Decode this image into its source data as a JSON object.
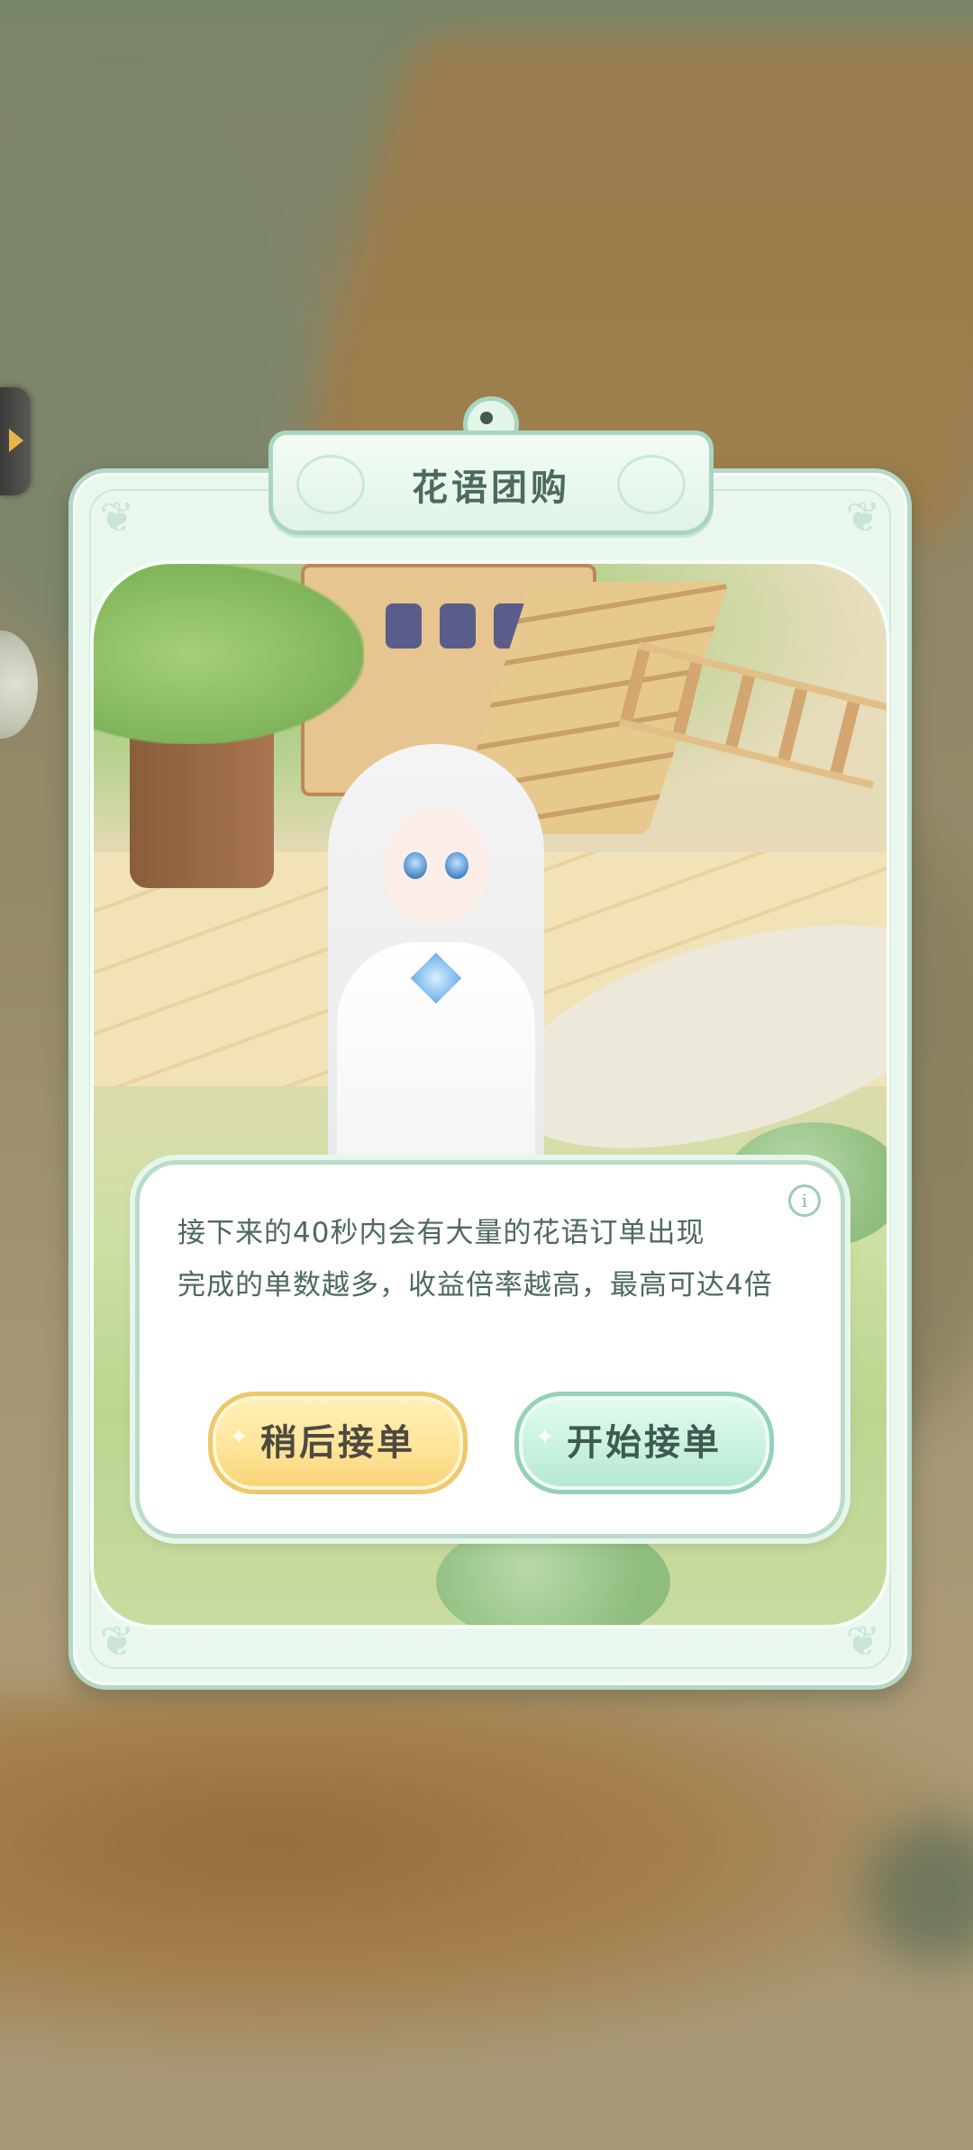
{
  "dialog": {
    "title": "花语团购",
    "message_lines": [
      "接下来的40秒内会有大量的花语订单出现",
      "完成的单数越多，收益倍率越高，最高可达4倍"
    ],
    "buttons": {
      "later_label": "稍后接单",
      "start_label": "开始接单"
    }
  },
  "icons": {
    "info": "info-icon",
    "side_arrow": "play-arrow-icon"
  },
  "colors": {
    "panel_bg": "#eaf7ec",
    "panel_border": "#b5d8c6",
    "text": "#4d6a5c",
    "later_button": "#ffe49a",
    "start_button": "#c9f2de"
  }
}
